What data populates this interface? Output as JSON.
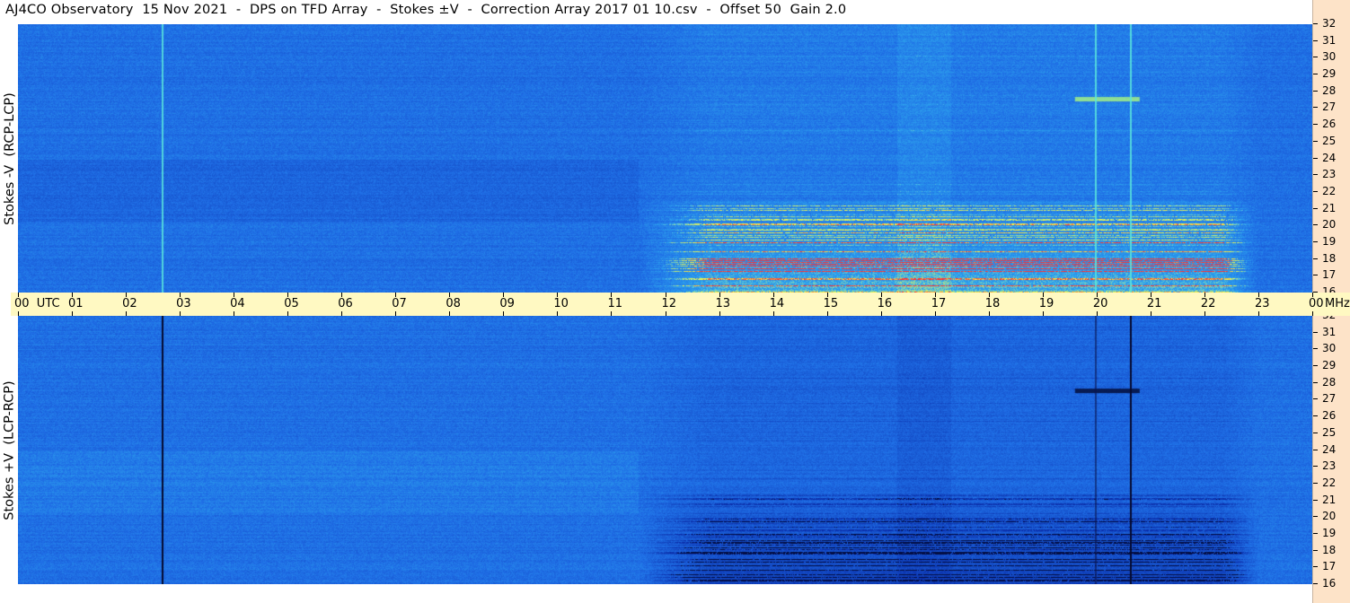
{
  "title": "AJ4CO Observatory  15 Nov 2021  -  DPS on TFD Array  -  Stokes ±V  -  Correction Array 2017 01 10.csv  -  Offset 50  Gain 2.0",
  "panels": [
    {
      "label": "Stokes -V  (RCP-LCP)"
    },
    {
      "label": "Stokes +V  (LCP-RCP)"
    }
  ],
  "time_axis": {
    "labels": [
      "00  UTC",
      "01",
      "02",
      "03",
      "04",
      "05",
      "06",
      "07",
      "08",
      "09",
      "10",
      "11",
      "12",
      "13",
      "14",
      "15",
      "16",
      "17",
      "18",
      "19",
      "20",
      "21",
      "22",
      "23",
      "00"
    ],
    "unit": "MHz"
  },
  "freq_axis": {
    "labels": [
      "32",
      "31",
      "30",
      "29",
      "28",
      "27",
      "26",
      "25",
      "24",
      "23",
      "22",
      "21",
      "20",
      "19",
      "18",
      "17",
      "16"
    ]
  },
  "chart_data": {
    "type": "heatmap",
    "title": "AJ4CO Observatory  15 Nov 2021  -  DPS on TFD Array  -  Stokes ±V  -  Correction Array 2017 01 10.csv  -  Offset 50  Gain 2.0",
    "x": {
      "label": "UTC",
      "range_hours": [
        0,
        24
      ],
      "ticks": [
        "00",
        "01",
        "02",
        "03",
        "04",
        "05",
        "06",
        "07",
        "08",
        "09",
        "10",
        "11",
        "12",
        "13",
        "14",
        "15",
        "16",
        "17",
        "18",
        "19",
        "20",
        "21",
        "22",
        "23",
        "00"
      ]
    },
    "y": {
      "unit": "MHz",
      "range": [
        16,
        32
      ],
      "ticks": [
        32,
        31,
        30,
        29,
        28,
        27,
        26,
        25,
        24,
        23,
        22,
        21,
        20,
        19,
        18,
        17,
        16
      ]
    },
    "series": [
      {
        "name": "Stokes -V  (RCP-LCP)",
        "activity_hours": [
          11.5,
          23.0
        ],
        "bright_band_mhz": [
          16,
          21.5
        ],
        "narrow_feature_mhz": 27.5
      },
      {
        "name": "Stokes +V  (LCP-RCP)",
        "activity_hours": [
          11.5,
          23.0
        ],
        "dark_band_mhz": [
          16,
          21.5
        ],
        "narrow_feature_mhz": 27.5
      }
    ],
    "vertical_markers_hours": [
      2.66,
      19.97,
      20.62
    ],
    "colors": {
      "background": "#1f6ee6",
      "low": "#0a2ca8",
      "high": "#ffff40",
      "extreme": "#ff3030"
    }
  }
}
